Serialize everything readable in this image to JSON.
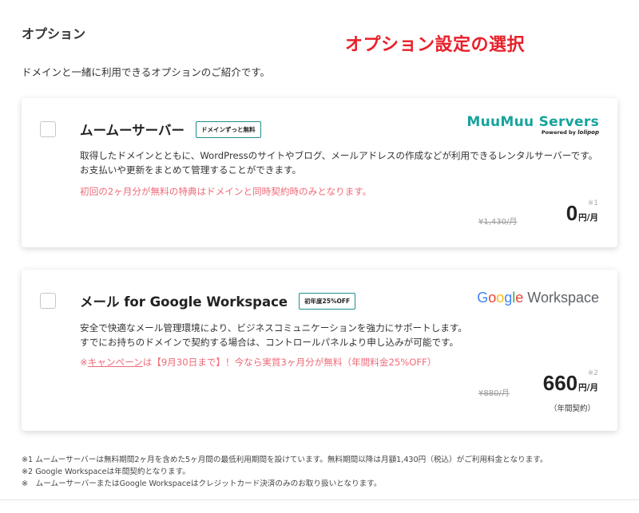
{
  "section": {
    "title": "オプション",
    "overlay_title": "オプション設定の選択",
    "intro": "ドメインと一緒に利用できるオプションのご紹介です。"
  },
  "options": [
    {
      "name": "ムームーサーバー",
      "badge": "ドメインずっと無料",
      "logo_brand": "MuuMuu Servers",
      "logo_powered": "Powered by",
      "logo_powered_brand": "lolipop",
      "description": "取得したドメインとともに、WordPressのサイトやブログ、メールアドレスの作成などが利用できるレンタルサーバーです。お支払いや更新をまとめて管理することができます。",
      "note": "初回の2ヶ月分が無料の特典はドメインと同時契約時のみとなります。",
      "old_price": "¥1,430/月",
      "price": "0",
      "price_unit": "円/月",
      "note_mark": "※1",
      "checked": false
    },
    {
      "name": "メール for Google Workspace",
      "badge": "初年度25%OFF",
      "logo_text": "Workspace",
      "description_line1": "安全で快適なメール管理環境により、ビジネスコミュニケーションを強力にサポートします。",
      "description_line2": "すでにお持ちのドメインで契約する場合は、コントロールパネルより申し込みが可能です。",
      "note_prefix": "※",
      "note_link": "キャンペーン",
      "note_suffix": "は【9月30日まで】！今なら実質3ヶ月分が無料（年間料金25%OFF）",
      "old_price": "¥880/月",
      "price": "660",
      "price_unit": "円/月",
      "note_mark": "※2",
      "contract": "（年間契約）",
      "checked": false
    }
  ],
  "footnotes": [
    "※1 ムームーサーバーは無料期間2ヶ月を含めた5ヶ月間の最低利用期間を設けています。無料期間以降は月額1,430円（税込）がご利用料金となります。",
    "※2 Google Workspaceは年間契約となります。",
    "※　ムームーサーバーまたはGoogle Workspaceはクレジットカード決済のみのお取り扱いとなります。"
  ],
  "colors": {
    "accent_teal": "#1e8f8a",
    "note_red": "#ef6a77",
    "overlay_red": "#e8202a",
    "muumuu_teal": "#16a39c"
  }
}
